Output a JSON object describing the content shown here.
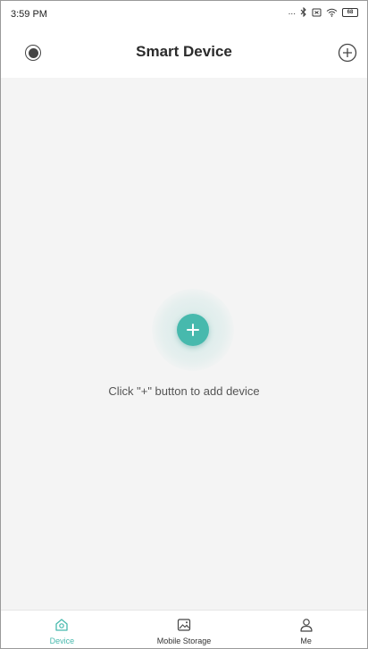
{
  "status_bar": {
    "time": "3:59 PM",
    "more": "...",
    "battery": "68"
  },
  "header": {
    "title": "Smart Device",
    "left_icon": "menu-circle-icon",
    "right_icon": "plus-circle-icon"
  },
  "content": {
    "add_icon": "plus-icon",
    "hint_text": "Click \"+\" button to add device"
  },
  "bottom_nav": {
    "items": [
      {
        "label": "Device",
        "icon": "device-icon",
        "active": true
      },
      {
        "label": "Mobile Storage",
        "icon": "image-icon",
        "active": false
      },
      {
        "label": "Me",
        "icon": "person-icon",
        "active": false
      }
    ]
  },
  "colors": {
    "accent": "#47b9ad",
    "background": "#f4f4f4",
    "title": "#2b2b2b"
  }
}
